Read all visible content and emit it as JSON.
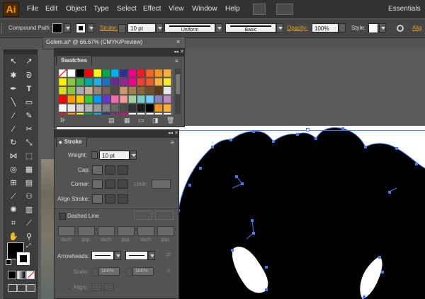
{
  "app": {
    "logo": "Ai",
    "workspace": "Essentials"
  },
  "menu": [
    "File",
    "Edit",
    "Object",
    "Type",
    "Select",
    "Effect",
    "View",
    "Window",
    "Help"
  ],
  "control_bar": {
    "selection_type": "Compound Path",
    "stroke_label": "Stroke:",
    "stroke_weight": "10 pt",
    "profile": "Uniform",
    "brush": "Basic",
    "opacity_label": "Opacity:",
    "opacity_value": "100%",
    "style_label": "Style:",
    "align_label": "Alig",
    "colors": {
      "fill": "#000000",
      "accent": "#e8a020"
    }
  },
  "document_tab": {
    "title": "Golem.ai* @ 66.67% (CMYK/Preview)"
  },
  "swatches_panel": {
    "title": "Swatches",
    "colors": [
      [
        "none",
        "#ffffff",
        "#000000",
        "#ff0000",
        "#ffff00",
        "#00a651",
        "#00aeef",
        "#2e3192",
        "#ec008c",
        "#ed1c24",
        "#f26522",
        "#f7941d",
        "#fbb040"
      ],
      [
        "#fff200",
        "#8dc63f",
        "#39b54a",
        "#00a99d",
        "#27aae1",
        "#1c75bc",
        "#662d91",
        "#92278f",
        "#ec008c",
        "#ef4136",
        "#f15a29",
        "#fbb040",
        "#f9ed32"
      ],
      [
        "#d7df23",
        "#8dc63f",
        "#a7a9ac",
        "#c7b299",
        "#998675",
        "#736357",
        "#534741",
        "#c69c6d",
        "#a67c52",
        "#8c6239",
        "#754c24",
        "#603813",
        "#e6e7e8"
      ],
      [
        "#ff0000",
        "#ff9900",
        "#ffcc00",
        "#33cc33",
        "#0099ff",
        "#6633cc",
        "#f06eaa",
        "#f5989d",
        "#a3d39c",
        "#7accc8",
        "#6dcff6",
        "#8781bd",
        "#bd8cbf"
      ],
      [
        "#ffffff",
        "#e6e6e6",
        "#cccccc",
        "#b3b3b3",
        "#999999",
        "#808080",
        "#666666",
        "#4d4d4d",
        "#333333",
        "#1a1a1a",
        "#000000",
        "#f7941d",
        "#fbb040"
      ],
      [
        "#ed1c24",
        "#f7941d",
        "#fff200",
        "#00a651",
        "#00aeef",
        "#2e3192",
        "#92278f",
        "#ec008c",
        "#ffffff",
        "#ffffff",
        "#ffffff",
        "#ffffff",
        "#ffffff"
      ]
    ]
  },
  "stroke_panel": {
    "title": "Stroke",
    "weight_label": "Weight:",
    "weight_value": "10 pt",
    "cap_label": "Cap:",
    "corner_label": "Corner:",
    "limit_label": "Limit:",
    "align_label": "Align Stroke:",
    "dashed_label": "Dashed Line",
    "dash": [
      "dash",
      "gap",
      "dash",
      "gap",
      "dash",
      "gap"
    ],
    "arrowheads_label": "Arrowheads:",
    "scale_label": "Scale:",
    "scale_start": "100%",
    "scale_end": "100%",
    "align_label2": "Align:"
  }
}
